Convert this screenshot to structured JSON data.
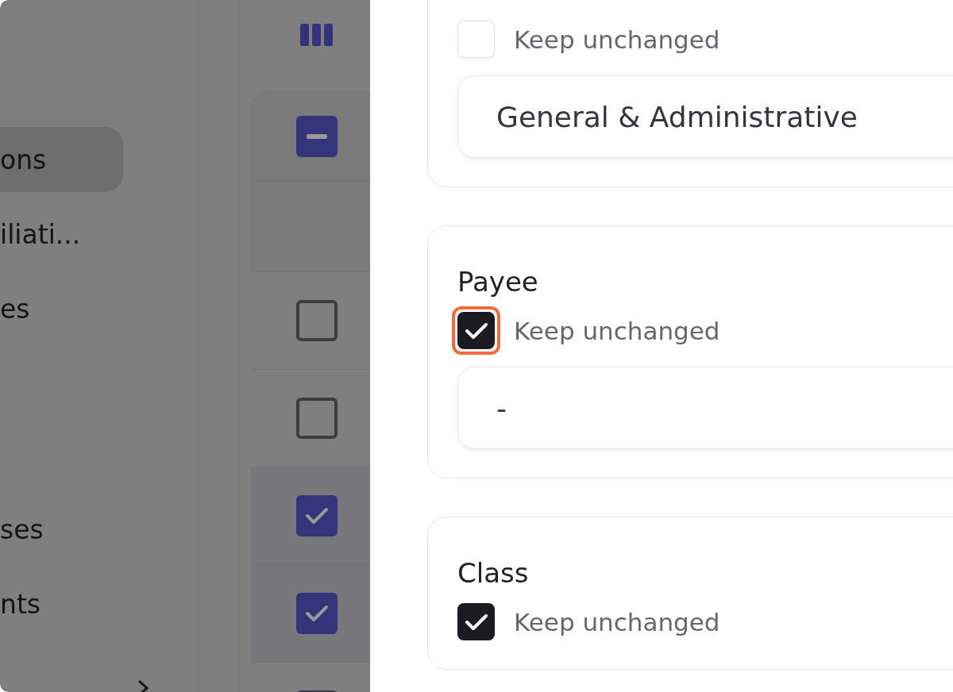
{
  "sidebar": {
    "sections": [
      {
        "items": [
          {
            "label": "ons",
            "selected": true
          },
          {
            "label": "iliati...",
            "selected": false
          },
          {
            "label": "es",
            "selected": false
          }
        ]
      },
      {
        "items": [
          {
            "label": "ses",
            "selected": false
          },
          {
            "label": "nts",
            "selected": false
          }
        ]
      }
    ]
  },
  "table": {
    "header_checkbox": {
      "indeterminate": true
    },
    "rows": [
      {
        "checked": false
      },
      {
        "checked": false
      },
      {
        "checked": true
      },
      {
        "checked": true
      },
      {
        "checked": false
      }
    ]
  },
  "panel": {
    "fields": [
      {
        "keep_unchanged": {
          "label": "Keep unchanged",
          "checked": false,
          "highlighted": false
        },
        "value": "General & Administrative"
      },
      {
        "title": "Payee",
        "keep_unchanged": {
          "label": "Keep unchanged",
          "checked": true,
          "highlighted": true
        },
        "value": "-"
      },
      {
        "title": "Class",
        "keep_unchanged": {
          "label": "Keep unchanged",
          "checked": true,
          "highlighted": false
        }
      }
    ]
  }
}
